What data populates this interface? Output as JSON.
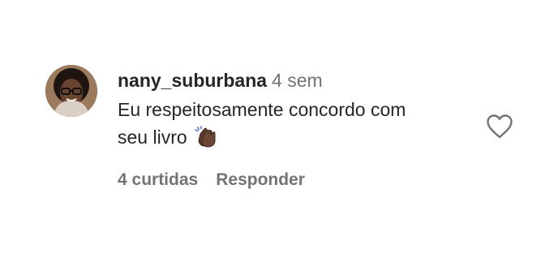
{
  "comment": {
    "username": "nany_suburbana",
    "timestamp": "4 sem",
    "text_line1": "Eu respeitosamente concordo com",
    "text_line2": "seu livro",
    "emoji_icon": "clapping-hands-icon",
    "likes_label": "4 curtidas",
    "reply_label": "Responder",
    "like_icon": "heart-icon"
  },
  "colors": {
    "primary_text": "#262626",
    "secondary_text": "#737373"
  }
}
